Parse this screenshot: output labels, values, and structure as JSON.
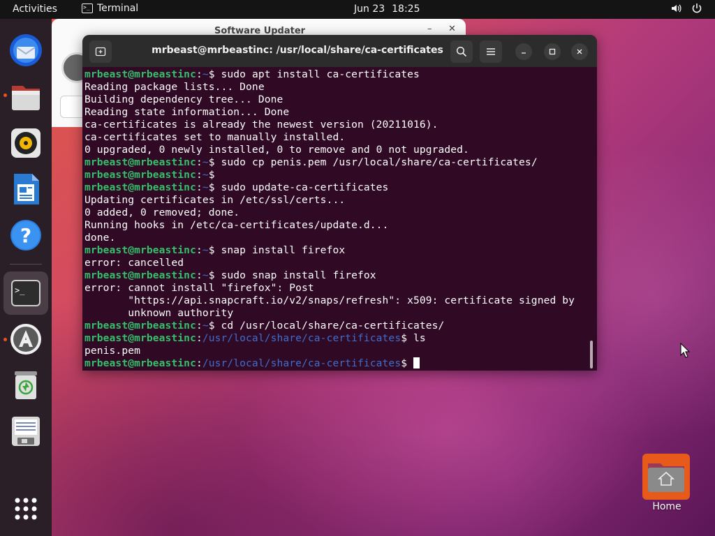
{
  "topbar": {
    "activities": "Activities",
    "app_name": "Terminal",
    "app_icon_glyph": ">_",
    "date": "Jun 23",
    "time": "18:25",
    "volume_icon": "volume-icon",
    "power_icon": "power-icon"
  },
  "dock": {
    "items": [
      {
        "name": "thunderbird",
        "icon": "thunderbird-icon",
        "running": false
      },
      {
        "name": "files",
        "icon": "files-icon",
        "running": true
      },
      {
        "name": "rhythmbox",
        "icon": "rhythmbox-icon",
        "running": false
      },
      {
        "name": "libreoffice-writer",
        "icon": "writer-icon",
        "running": false
      },
      {
        "name": "help",
        "icon": "help-icon",
        "running": false
      },
      {
        "name": "terminal",
        "icon": "terminal-icon",
        "running": true
      },
      {
        "name": "software",
        "icon": "software-icon",
        "running": true
      },
      {
        "name": "trash",
        "icon": "trash-icon",
        "running": false
      },
      {
        "name": "disk",
        "icon": "disk-icon",
        "running": false
      },
      {
        "name": "show-apps",
        "icon": "grid-icon",
        "running": false
      }
    ]
  },
  "updater": {
    "title": "Software Updater",
    "minimize": "–",
    "close": "✕"
  },
  "terminal": {
    "title": "mrbeast@mrbeastinc: /usr/local/share/ca-certificates",
    "prompt_user": "mrbeast@mrbeastinc",
    "lines": [
      {
        "type": "prompt",
        "path": "~",
        "cmd": "sudo apt install ca-certificates"
      },
      {
        "type": "out",
        "text": "Reading package lists... Done"
      },
      {
        "type": "out",
        "text": "Building dependency tree... Done"
      },
      {
        "type": "out",
        "text": "Reading state information... Done"
      },
      {
        "type": "out",
        "text": "ca-certificates is already the newest version (20211016)."
      },
      {
        "type": "out",
        "text": "ca-certificates set to manually installed."
      },
      {
        "type": "out",
        "text": "0 upgraded, 0 newly installed, 0 to remove and 0 not upgraded."
      },
      {
        "type": "prompt",
        "path": "~",
        "cmd": "sudo cp penis.pem /usr/local/share/ca-certificates/"
      },
      {
        "type": "prompt",
        "path": "~",
        "cmd": ""
      },
      {
        "type": "prompt",
        "path": "~",
        "cmd": "sudo update-ca-certificates"
      },
      {
        "type": "out",
        "text": "Updating certificates in /etc/ssl/certs..."
      },
      {
        "type": "out",
        "text": "0 added, 0 removed; done."
      },
      {
        "type": "out",
        "text": "Running hooks in /etc/ca-certificates/update.d..."
      },
      {
        "type": "out",
        "text": "done."
      },
      {
        "type": "prompt",
        "path": "~",
        "cmd": "snap install firefox"
      },
      {
        "type": "out",
        "text": "error: cancelled"
      },
      {
        "type": "prompt",
        "path": "~",
        "cmd": "sudo snap install firefox"
      },
      {
        "type": "out",
        "text": "error: cannot install \"firefox\": Post"
      },
      {
        "type": "out",
        "text": "       \"https://api.snapcraft.io/v2/snaps/refresh\": x509: certificate signed by"
      },
      {
        "type": "out",
        "text": "       unknown authority"
      },
      {
        "type": "prompt",
        "path": "~",
        "cmd": "cd /usr/local/share/ca-certificates/"
      },
      {
        "type": "prompt",
        "path": "/usr/local/share/ca-certificates",
        "cmd": "ls"
      },
      {
        "type": "out",
        "text": "penis.pem"
      },
      {
        "type": "prompt",
        "path": "/usr/local/share/ca-certificates",
        "cmd": "",
        "cursor": true
      }
    ]
  },
  "desktop": {
    "home_label": "Home"
  }
}
